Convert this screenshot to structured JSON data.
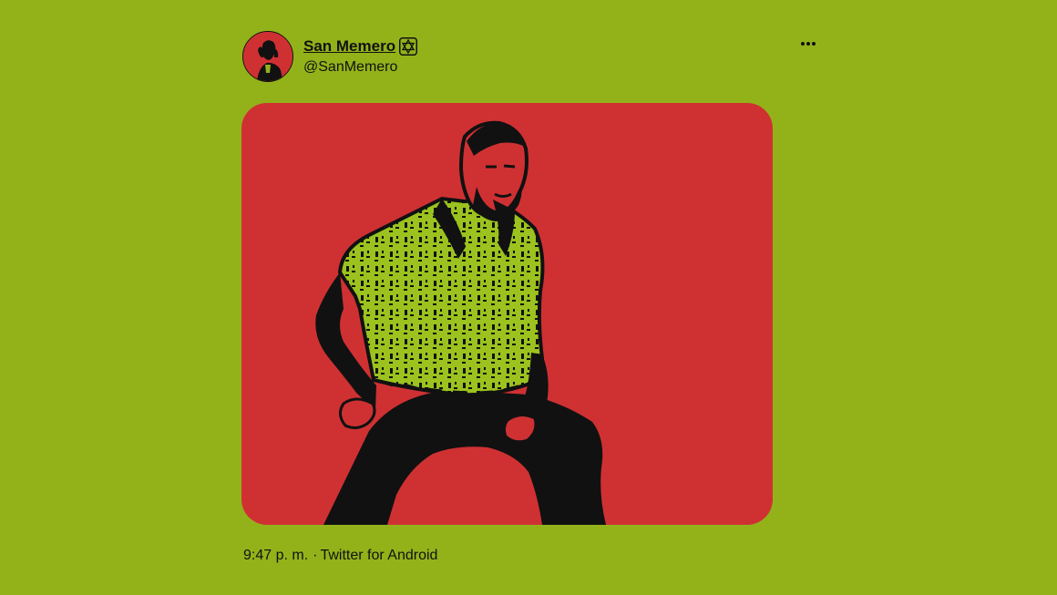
{
  "tweet": {
    "author": {
      "display_name": "San Memero",
      "handle": "@SanMemero",
      "badge_icon": "star-of-david-icon",
      "avatar_icon": "profile-avatar-icon"
    },
    "more_icon": "ellipsis-icon",
    "media": {
      "alt_icon": "photo-icon"
    },
    "timestamp": "9:47 p. m.",
    "separator": "·",
    "source": "Twitter for Android"
  },
  "colors": {
    "background": "#93b21a",
    "media_background": "#cf3133",
    "shirt": "#9bc21e",
    "ink": "#111111"
  }
}
